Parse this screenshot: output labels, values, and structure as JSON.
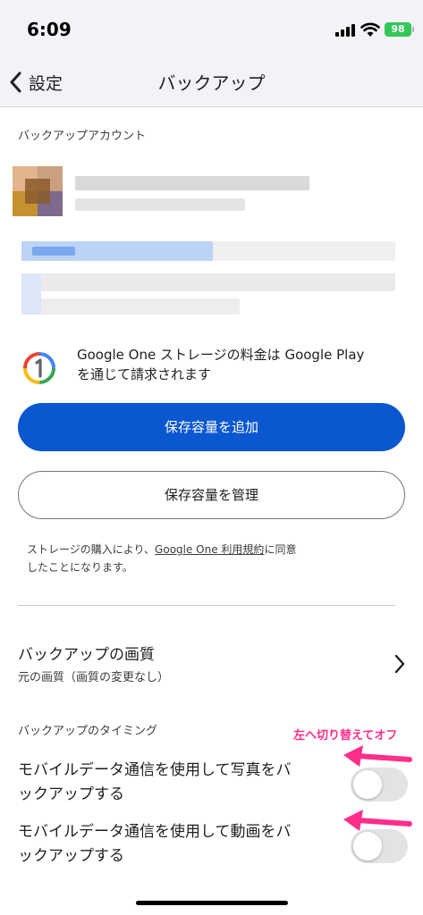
{
  "status_bar": {
    "time": "6:09",
    "battery": "98"
  },
  "nav": {
    "back_label": "設定",
    "title": "バックアップ"
  },
  "backup_account": {
    "section_label": "バックアップアカウント"
  },
  "google_one": {
    "notice_line1": "Google One ストレージの料金は Google Play",
    "notice_line2": "を通じて請求されます"
  },
  "buttons": {
    "add_storage": "保存容量を追加",
    "manage_storage": "保存容量を管理"
  },
  "terms": {
    "prefix": "ストレージの購入により、",
    "link": "Google One 利用規約",
    "suffix": "に同意",
    "line2": "したことになります。"
  },
  "quality": {
    "title": "バックアップの画質",
    "subtitle": "元の画質（画質の変更なし）"
  },
  "timing": {
    "section_label": "バックアップのタイミング"
  },
  "annotation": {
    "text": "左へ切り替えてオフ",
    "color": "#ff2f8a"
  },
  "toggles": {
    "photos": {
      "line1": "モバイルデータ通信を使用して写真をバ",
      "line2": "ックアップする",
      "on": false
    },
    "videos": {
      "line1": "モバイルデータ通信を使用して動画をバ",
      "line2": "ックアップする",
      "on": false
    }
  },
  "colors": {
    "primary": "#0b57d0",
    "bar_bg": "#f2f2f7",
    "battery": "#34c759"
  }
}
